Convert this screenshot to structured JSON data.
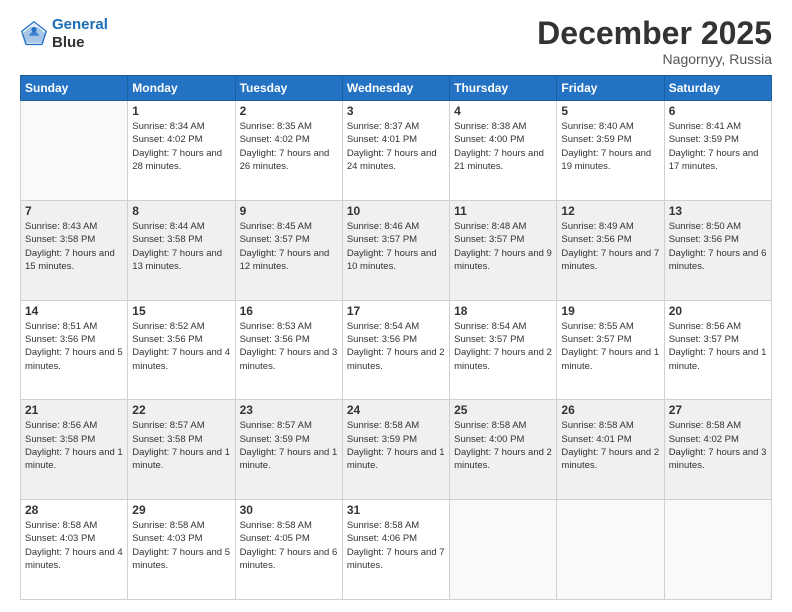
{
  "header": {
    "logo_line1": "General",
    "logo_line2": "Blue",
    "month": "December 2025",
    "location": "Nagornyy, Russia"
  },
  "weekdays": [
    "Sunday",
    "Monday",
    "Tuesday",
    "Wednesday",
    "Thursday",
    "Friday",
    "Saturday"
  ],
  "weeks": [
    [
      {
        "day": "",
        "sunrise": "",
        "sunset": "",
        "daylight": ""
      },
      {
        "day": "1",
        "sunrise": "Sunrise: 8:34 AM",
        "sunset": "Sunset: 4:02 PM",
        "daylight": "Daylight: 7 hours and 28 minutes."
      },
      {
        "day": "2",
        "sunrise": "Sunrise: 8:35 AM",
        "sunset": "Sunset: 4:02 PM",
        "daylight": "Daylight: 7 hours and 26 minutes."
      },
      {
        "day": "3",
        "sunrise": "Sunrise: 8:37 AM",
        "sunset": "Sunset: 4:01 PM",
        "daylight": "Daylight: 7 hours and 24 minutes."
      },
      {
        "day": "4",
        "sunrise": "Sunrise: 8:38 AM",
        "sunset": "Sunset: 4:00 PM",
        "daylight": "Daylight: 7 hours and 21 minutes."
      },
      {
        "day": "5",
        "sunrise": "Sunrise: 8:40 AM",
        "sunset": "Sunset: 3:59 PM",
        "daylight": "Daylight: 7 hours and 19 minutes."
      },
      {
        "day": "6",
        "sunrise": "Sunrise: 8:41 AM",
        "sunset": "Sunset: 3:59 PM",
        "daylight": "Daylight: 7 hours and 17 minutes."
      }
    ],
    [
      {
        "day": "7",
        "sunrise": "Sunrise: 8:43 AM",
        "sunset": "Sunset: 3:58 PM",
        "daylight": "Daylight: 7 hours and 15 minutes."
      },
      {
        "day": "8",
        "sunrise": "Sunrise: 8:44 AM",
        "sunset": "Sunset: 3:58 PM",
        "daylight": "Daylight: 7 hours and 13 minutes."
      },
      {
        "day": "9",
        "sunrise": "Sunrise: 8:45 AM",
        "sunset": "Sunset: 3:57 PM",
        "daylight": "Daylight: 7 hours and 12 minutes."
      },
      {
        "day": "10",
        "sunrise": "Sunrise: 8:46 AM",
        "sunset": "Sunset: 3:57 PM",
        "daylight": "Daylight: 7 hours and 10 minutes."
      },
      {
        "day": "11",
        "sunrise": "Sunrise: 8:48 AM",
        "sunset": "Sunset: 3:57 PM",
        "daylight": "Daylight: 7 hours and 9 minutes."
      },
      {
        "day": "12",
        "sunrise": "Sunrise: 8:49 AM",
        "sunset": "Sunset: 3:56 PM",
        "daylight": "Daylight: 7 hours and 7 minutes."
      },
      {
        "day": "13",
        "sunrise": "Sunrise: 8:50 AM",
        "sunset": "Sunset: 3:56 PM",
        "daylight": "Daylight: 7 hours and 6 minutes."
      }
    ],
    [
      {
        "day": "14",
        "sunrise": "Sunrise: 8:51 AM",
        "sunset": "Sunset: 3:56 PM",
        "daylight": "Daylight: 7 hours and 5 minutes."
      },
      {
        "day": "15",
        "sunrise": "Sunrise: 8:52 AM",
        "sunset": "Sunset: 3:56 PM",
        "daylight": "Daylight: 7 hours and 4 minutes."
      },
      {
        "day": "16",
        "sunrise": "Sunrise: 8:53 AM",
        "sunset": "Sunset: 3:56 PM",
        "daylight": "Daylight: 7 hours and 3 minutes."
      },
      {
        "day": "17",
        "sunrise": "Sunrise: 8:54 AM",
        "sunset": "Sunset: 3:56 PM",
        "daylight": "Daylight: 7 hours and 2 minutes."
      },
      {
        "day": "18",
        "sunrise": "Sunrise: 8:54 AM",
        "sunset": "Sunset: 3:57 PM",
        "daylight": "Daylight: 7 hours and 2 minutes."
      },
      {
        "day": "19",
        "sunrise": "Sunrise: 8:55 AM",
        "sunset": "Sunset: 3:57 PM",
        "daylight": "Daylight: 7 hours and 1 minute."
      },
      {
        "day": "20",
        "sunrise": "Sunrise: 8:56 AM",
        "sunset": "Sunset: 3:57 PM",
        "daylight": "Daylight: 7 hours and 1 minute."
      }
    ],
    [
      {
        "day": "21",
        "sunrise": "Sunrise: 8:56 AM",
        "sunset": "Sunset: 3:58 PM",
        "daylight": "Daylight: 7 hours and 1 minute."
      },
      {
        "day": "22",
        "sunrise": "Sunrise: 8:57 AM",
        "sunset": "Sunset: 3:58 PM",
        "daylight": "Daylight: 7 hours and 1 minute."
      },
      {
        "day": "23",
        "sunrise": "Sunrise: 8:57 AM",
        "sunset": "Sunset: 3:59 PM",
        "daylight": "Daylight: 7 hours and 1 minute."
      },
      {
        "day": "24",
        "sunrise": "Sunrise: 8:58 AM",
        "sunset": "Sunset: 3:59 PM",
        "daylight": "Daylight: 7 hours and 1 minute."
      },
      {
        "day": "25",
        "sunrise": "Sunrise: 8:58 AM",
        "sunset": "Sunset: 4:00 PM",
        "daylight": "Daylight: 7 hours and 2 minutes."
      },
      {
        "day": "26",
        "sunrise": "Sunrise: 8:58 AM",
        "sunset": "Sunset: 4:01 PM",
        "daylight": "Daylight: 7 hours and 2 minutes."
      },
      {
        "day": "27",
        "sunrise": "Sunrise: 8:58 AM",
        "sunset": "Sunset: 4:02 PM",
        "daylight": "Daylight: 7 hours and 3 minutes."
      }
    ],
    [
      {
        "day": "28",
        "sunrise": "Sunrise: 8:58 AM",
        "sunset": "Sunset: 4:03 PM",
        "daylight": "Daylight: 7 hours and 4 minutes."
      },
      {
        "day": "29",
        "sunrise": "Sunrise: 8:58 AM",
        "sunset": "Sunset: 4:03 PM",
        "daylight": "Daylight: 7 hours and 5 minutes."
      },
      {
        "day": "30",
        "sunrise": "Sunrise: 8:58 AM",
        "sunset": "Sunset: 4:05 PM",
        "daylight": "Daylight: 7 hours and 6 minutes."
      },
      {
        "day": "31",
        "sunrise": "Sunrise: 8:58 AM",
        "sunset": "Sunset: 4:06 PM",
        "daylight": "Daylight: 7 hours and 7 minutes."
      },
      {
        "day": "",
        "sunrise": "",
        "sunset": "",
        "daylight": ""
      },
      {
        "day": "",
        "sunrise": "",
        "sunset": "",
        "daylight": ""
      },
      {
        "day": "",
        "sunrise": "",
        "sunset": "",
        "daylight": ""
      }
    ]
  ]
}
